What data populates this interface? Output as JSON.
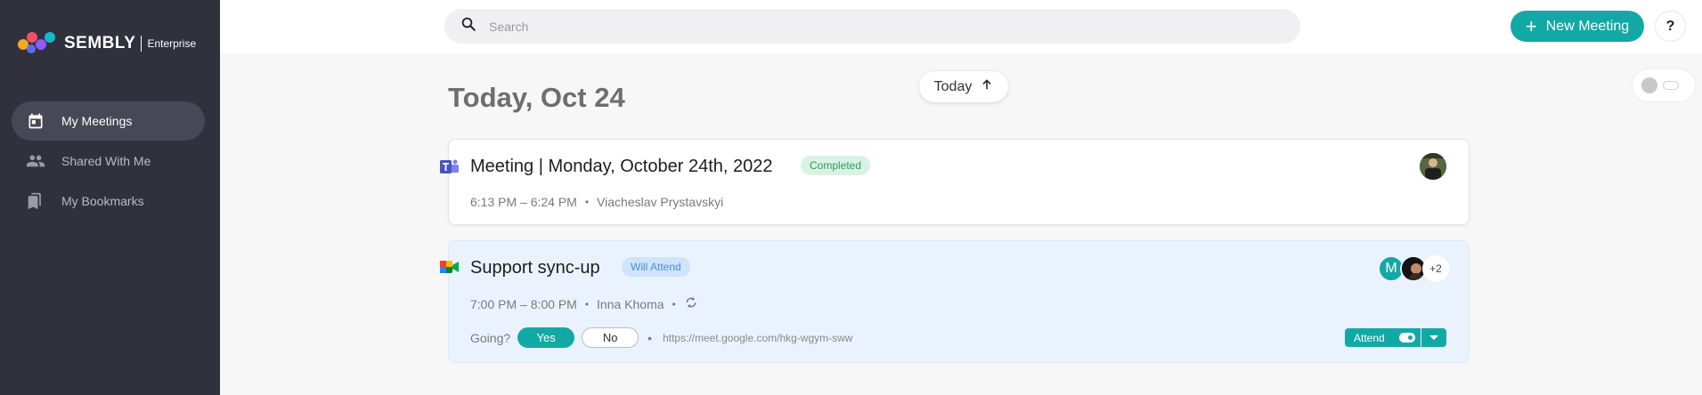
{
  "sidebar": {
    "logo": {
      "name": "SEMBLY",
      "sub": "Enterprise"
    },
    "items": [
      {
        "label": "My Meetings",
        "icon": "calendar-icon",
        "active": true
      },
      {
        "label": "Shared With Me",
        "icon": "people-icon",
        "active": false
      },
      {
        "label": "My Bookmarks",
        "icon": "bookmarks-icon",
        "active": false
      }
    ]
  },
  "header": {
    "search_placeholder": "Search",
    "new_meeting_label": "New Meeting",
    "help_label": "?"
  },
  "main": {
    "date_heading": "Today, Oct 24",
    "today_pill": "Today",
    "meetings": [
      {
        "platform": "teams-icon",
        "title": "Meeting | Monday, October 24th, 2022",
        "status": "Completed",
        "time": "6:13 PM – 6:24 PM",
        "owner": "Viacheslav Prystavskyi"
      },
      {
        "platform": "google-meet-icon",
        "title": "Support sync-up",
        "status": "Will Attend",
        "time": "7:00 PM – 8:00 PM",
        "owner": "Inna Khoma",
        "recurring_icon": "recurring-icon",
        "going_label": "Going?",
        "yes_label": "Yes",
        "no_label": "No",
        "link": "https://meet.google.com/hkg-wgym-sww",
        "attendees_avatar_letter": "M",
        "attendees_more": "+2",
        "attend_label": "Attend"
      }
    ]
  },
  "colors": {
    "sidebar_bg": "#30313d",
    "accent": "#12a9a5",
    "completed_bg": "#d9f2e4",
    "will_attend_bg": "#cfe3fb"
  }
}
